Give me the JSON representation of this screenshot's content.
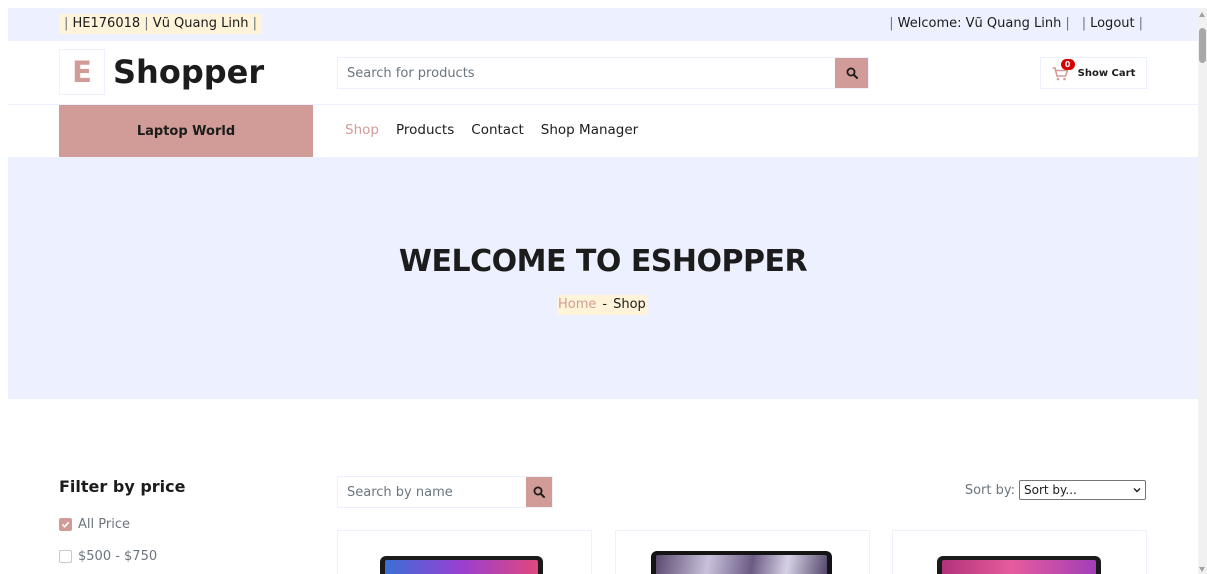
{
  "topbar": {
    "student_id": "HE176018",
    "student_name": "Vũ Quang Linh",
    "welcome": "Welcome: Vũ Quang Linh",
    "logout": "Logout"
  },
  "header": {
    "logo_letter": "E",
    "logo_text": "Shopper",
    "search_placeholder": "Search for products",
    "cart_count": "0",
    "cart_label": "Show Cart"
  },
  "nav": {
    "category": "Laptop World",
    "links": [
      "Shop",
      "Products",
      "Contact",
      "Shop Manager"
    ]
  },
  "hero": {
    "title": "WELCOME TO ESHOPPER",
    "crumb_home": "Home",
    "crumb_sep": "-",
    "crumb_current": "Shop"
  },
  "filter": {
    "title": "Filter by price",
    "options": [
      {
        "label": "All Price",
        "checked": true
      },
      {
        "label": "$500 - $750",
        "checked": false
      }
    ]
  },
  "products_toolbar": {
    "search_placeholder": "Search by name",
    "sort_label": "Sort by:",
    "sort_value": "Sort by..."
  },
  "colors": {
    "primary": "#d19c97",
    "secondary": "#edf1ff",
    "highlight": "#fff3d9",
    "dark": "#1c1c1c"
  }
}
